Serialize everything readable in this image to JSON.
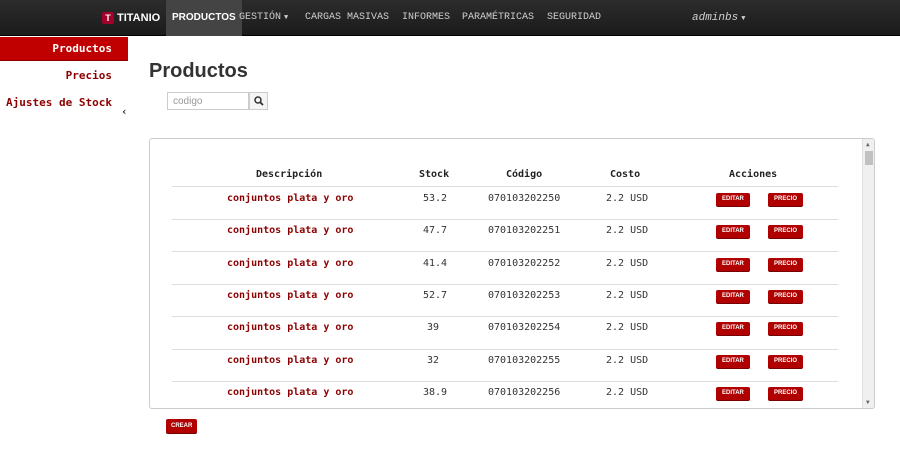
{
  "navbar": {
    "brand": "TITANIO",
    "brand_logo": "T",
    "items": [
      {
        "label": "PRODUCTOS"
      },
      {
        "label": "GESTIÓN"
      },
      {
        "label": "CARGAS MASIVAS"
      },
      {
        "label": "INFORMES"
      },
      {
        "label": "PARAMÉTRICAS"
      },
      {
        "label": "SEGURIDAD"
      }
    ],
    "caret": "▼",
    "user": "adminbs"
  },
  "sidebar": {
    "items": [
      {
        "label": "Productos"
      },
      {
        "label": "Precios"
      },
      {
        "label": "Ajustes de Stock"
      }
    ],
    "collapse_icon": "‹"
  },
  "main": {
    "title": "Productos",
    "search": {
      "placeholder": "codigo",
      "icon": "magnifier-icon"
    },
    "table": {
      "headers": [
        "Descripción",
        "Stock",
        "Código",
        "Costo",
        "Acciones"
      ],
      "rows": [
        {
          "descripcion": "conjuntos plata y oro",
          "stock": "53.2",
          "codigo": "070103202250",
          "costo": "2.2 USD"
        },
        {
          "descripcion": "conjuntos plata y oro",
          "stock": "47.7",
          "codigo": "070103202251",
          "costo": "2.2 USD"
        },
        {
          "descripcion": "conjuntos plata y oro",
          "stock": "41.4",
          "codigo": "070103202252",
          "costo": "2.2 USD"
        },
        {
          "descripcion": "conjuntos plata y oro",
          "stock": "52.7",
          "codigo": "070103202253",
          "costo": "2.2 USD"
        },
        {
          "descripcion": "conjuntos plata y oro",
          "stock": "39",
          "codigo": "070103202254",
          "costo": "2.2 USD"
        },
        {
          "descripcion": "conjuntos plata y oro",
          "stock": "32",
          "codigo": "070103202255",
          "costo": "2.2 USD"
        },
        {
          "descripcion": "conjuntos plata y oro",
          "stock": "38.9",
          "codigo": "070103202256",
          "costo": "2.2 USD"
        }
      ],
      "edit_label": "EDITAR",
      "price_label": "PRECIO"
    },
    "create_label": "CREAR"
  },
  "colors": {
    "accent": "#b00000",
    "navbar": "#1b1b1b",
    "link": "#8b0000"
  }
}
